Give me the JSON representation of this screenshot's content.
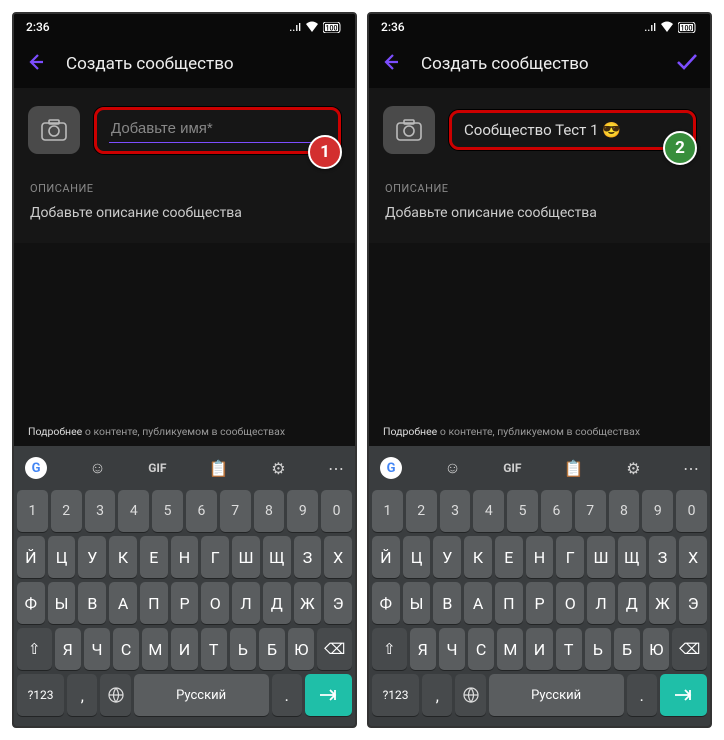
{
  "status": {
    "time": "2:36",
    "battery": "100"
  },
  "header": {
    "title": "Создать сообщество"
  },
  "screen1": {
    "name_placeholder": "Добавьте имя*",
    "name_value": "",
    "badge": "1"
  },
  "screen2": {
    "name_value": "Сообщество Тест 1 😎",
    "badge": "2"
  },
  "desc": {
    "label": "ОПИСАНИЕ",
    "placeholder": "Добавьте описание сообщества"
  },
  "policy": {
    "strong": "Подробнее",
    "rest": " о контенте, публикуемом в сообществах"
  },
  "keyboard": {
    "toolbar_gif": "GIF",
    "nums": [
      "1",
      "2",
      "3",
      "4",
      "5",
      "6",
      "7",
      "8",
      "9",
      "0"
    ],
    "row1": [
      "Й",
      "Ц",
      "У",
      "К",
      "Е",
      "Н",
      "Г",
      "Ш",
      "Щ",
      "З",
      "Х"
    ],
    "row2": [
      "Ф",
      "Ы",
      "В",
      "А",
      "П",
      "Р",
      "О",
      "Л",
      "Д",
      "Ж",
      "Э"
    ],
    "row3_mid": [
      "Я",
      "Ч",
      "С",
      "М",
      "И",
      "Т",
      "Ь",
      "Б",
      "Ю"
    ],
    "bottom": {
      "sym": "?123",
      "lang": "Русский"
    }
  }
}
